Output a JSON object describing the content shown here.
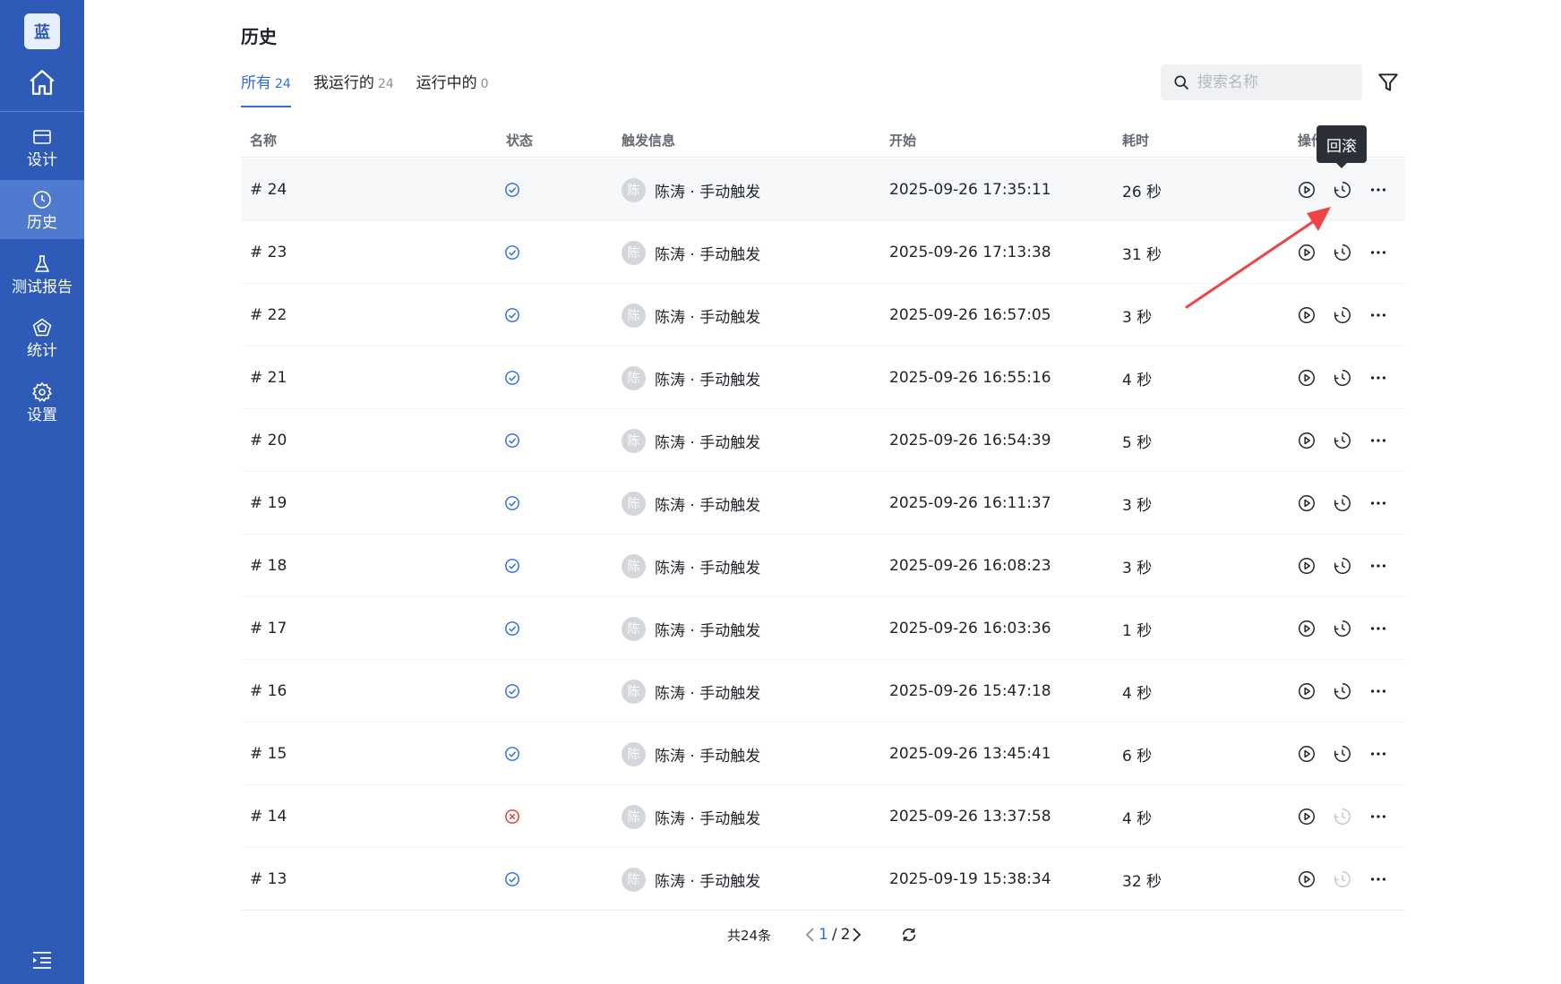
{
  "sidebar": {
    "logo": "蓝",
    "items": [
      {
        "label": "设计",
        "icon": "design-icon"
      },
      {
        "label": "历史",
        "icon": "clock-icon",
        "active": true
      },
      {
        "label": "测试报告",
        "icon": "flask-icon"
      },
      {
        "label": "统计",
        "icon": "stats-icon"
      },
      {
        "label": "设置",
        "icon": "gear-icon"
      }
    ]
  },
  "page": {
    "title": "历史"
  },
  "tabs": [
    {
      "label": "所有",
      "count": "24",
      "active": true
    },
    {
      "label": "我运行的",
      "count": "24"
    },
    {
      "label": "运行中的",
      "count": "0"
    }
  ],
  "search": {
    "placeholder": "搜索名称",
    "value": ""
  },
  "table": {
    "headers": {
      "name": "名称",
      "status": "状态",
      "trigger": "触发信息",
      "start": "开始",
      "duration": "耗时",
      "ops": "操作"
    },
    "rows": [
      {
        "name": "# 24",
        "status": "success",
        "avatar": "陈",
        "trigger": "陈涛 · 手动触发",
        "start": "2025-09-26 17:35:11",
        "duration": "26 秒",
        "rollback_enabled": true
      },
      {
        "name": "# 23",
        "status": "success",
        "avatar": "陈",
        "trigger": "陈涛 · 手动触发",
        "start": "2025-09-26 17:13:38",
        "duration": "31 秒",
        "rollback_enabled": true
      },
      {
        "name": "# 22",
        "status": "success",
        "avatar": "陈",
        "trigger": "陈涛 · 手动触发",
        "start": "2025-09-26 16:57:05",
        "duration": "3 秒",
        "rollback_enabled": true
      },
      {
        "name": "# 21",
        "status": "success",
        "avatar": "陈",
        "trigger": "陈涛 · 手动触发",
        "start": "2025-09-26 16:55:16",
        "duration": "4 秒",
        "rollback_enabled": true
      },
      {
        "name": "# 20",
        "status": "success",
        "avatar": "陈",
        "trigger": "陈涛 · 手动触发",
        "start": "2025-09-26 16:54:39",
        "duration": "5 秒",
        "rollback_enabled": true
      },
      {
        "name": "# 19",
        "status": "success",
        "avatar": "陈",
        "trigger": "陈涛 · 手动触发",
        "start": "2025-09-26 16:11:37",
        "duration": "3 秒",
        "rollback_enabled": true
      },
      {
        "name": "# 18",
        "status": "success",
        "avatar": "陈",
        "trigger": "陈涛 · 手动触发",
        "start": "2025-09-26 16:08:23",
        "duration": "3 秒",
        "rollback_enabled": true
      },
      {
        "name": "# 17",
        "status": "success",
        "avatar": "陈",
        "trigger": "陈涛 · 手动触发",
        "start": "2025-09-26 16:03:36",
        "duration": "1 秒",
        "rollback_enabled": true
      },
      {
        "name": "# 16",
        "status": "success",
        "avatar": "陈",
        "trigger": "陈涛 · 手动触发",
        "start": "2025-09-26 15:47:18",
        "duration": "4 秒",
        "rollback_enabled": true
      },
      {
        "name": "# 15",
        "status": "success",
        "avatar": "陈",
        "trigger": "陈涛 · 手动触发",
        "start": "2025-09-26 13:45:41",
        "duration": "6 秒",
        "rollback_enabled": true
      },
      {
        "name": "# 14",
        "status": "failed",
        "avatar": "陈",
        "trigger": "陈涛 · 手动触发",
        "start": "2025-09-26 13:37:58",
        "duration": "4 秒",
        "rollback_enabled": false
      },
      {
        "name": "# 13",
        "status": "success",
        "avatar": "陈",
        "trigger": "陈涛 · 手动触发",
        "start": "2025-09-19 15:38:34",
        "duration": "32 秒",
        "rollback_enabled": false
      }
    ]
  },
  "pagination": {
    "total": "共24条",
    "current": "1",
    "separator": "/",
    "pages": "2"
  },
  "tooltip": {
    "text": "回滚"
  },
  "colors": {
    "sidebar": "#2e5bb8",
    "accent": "#2e6be6",
    "success": "#2e6be6",
    "error": "#e53935",
    "annotation": "#ef4444"
  }
}
